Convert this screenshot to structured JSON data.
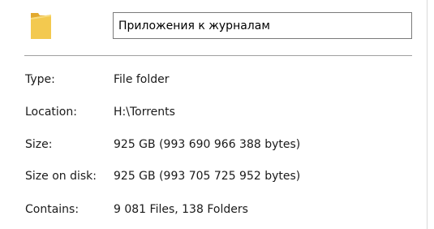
{
  "general": {
    "folder_name": "Приложения к журналам",
    "icon": "folder-icon",
    "properties": [
      {
        "key": "type",
        "label": "Type:",
        "value": "File folder"
      },
      {
        "key": "location",
        "label": "Location:",
        "value": "H:\\Torrents"
      },
      {
        "key": "size",
        "label": "Size:",
        "value": "925 GB (993 690 966 388 bytes)"
      },
      {
        "key": "size-on-disk",
        "label": "Size on disk:",
        "value": "925 GB (993 705 725 952 bytes)"
      },
      {
        "key": "contains",
        "label": "Contains:",
        "value": "9 081 Files, 138 Folders"
      }
    ]
  },
  "colors": {
    "folder_body": "#f3c94f",
    "folder_back": "#e2a92f",
    "border": "#7a7a7a",
    "separator": "#a0a0a0"
  }
}
